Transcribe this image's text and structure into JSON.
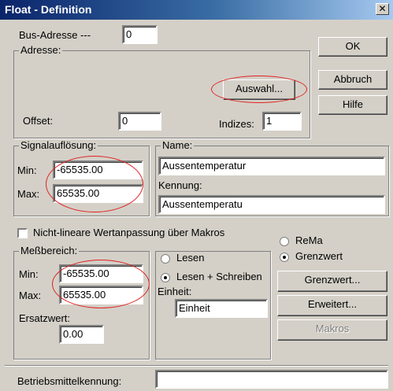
{
  "window": {
    "title": "Float - Definition",
    "close_label": "✕"
  },
  "bus": {
    "label": "Bus-Adresse ---",
    "value": "0"
  },
  "adresse": {
    "group_label": "Adresse:",
    "auswahl_label": "Auswahl...",
    "offset_label": "Offset:",
    "offset_value": "0",
    "indizes_label": "Indizes:",
    "indizes_value": "1"
  },
  "buttons": {
    "ok": "OK",
    "abbruch": "Abbruch",
    "hilfe": "Hilfe"
  },
  "signal": {
    "group_label": "Signalauflösung:",
    "min_label": "Min:",
    "min_value": "-65535.00",
    "max_label": "Max:",
    "max_value": "65535.00"
  },
  "name_group": {
    "group_label": "Name:",
    "name_value": "Aussentemperatur",
    "kennung_label": "Kennung:",
    "kennung_value": "Aussentemperatu"
  },
  "nonlinear": {
    "label": "Nicht-lineare Wertanpassung über Makros",
    "checked": false
  },
  "messbereich": {
    "group_label": "Meßbereich:",
    "min_label": "Min:",
    "min_value": "-65535.00",
    "max_label": "Max:",
    "max_value": "65535.00",
    "ersatz_label": "Ersatzwert:",
    "ersatz_value": "0.00"
  },
  "access": {
    "lesen_label": "Lesen",
    "lesen_schreiben_label": "Lesen + Schreiben",
    "selected": "Lesen + Schreiben",
    "einheit_label": "Einheit:",
    "einheit_value": "Einheit"
  },
  "mode": {
    "rema_label": "ReMa",
    "grenzwert_label": "Grenzwert",
    "selected": "Grenzwert"
  },
  "right_buttons": {
    "grenzwert": "Grenzwert...",
    "erweitert": "Erweitert...",
    "makros": "Makros"
  },
  "betriebsmittel": {
    "label": "Betriebsmittelkennung:",
    "value": ""
  },
  "annotation_color": "#e02020"
}
